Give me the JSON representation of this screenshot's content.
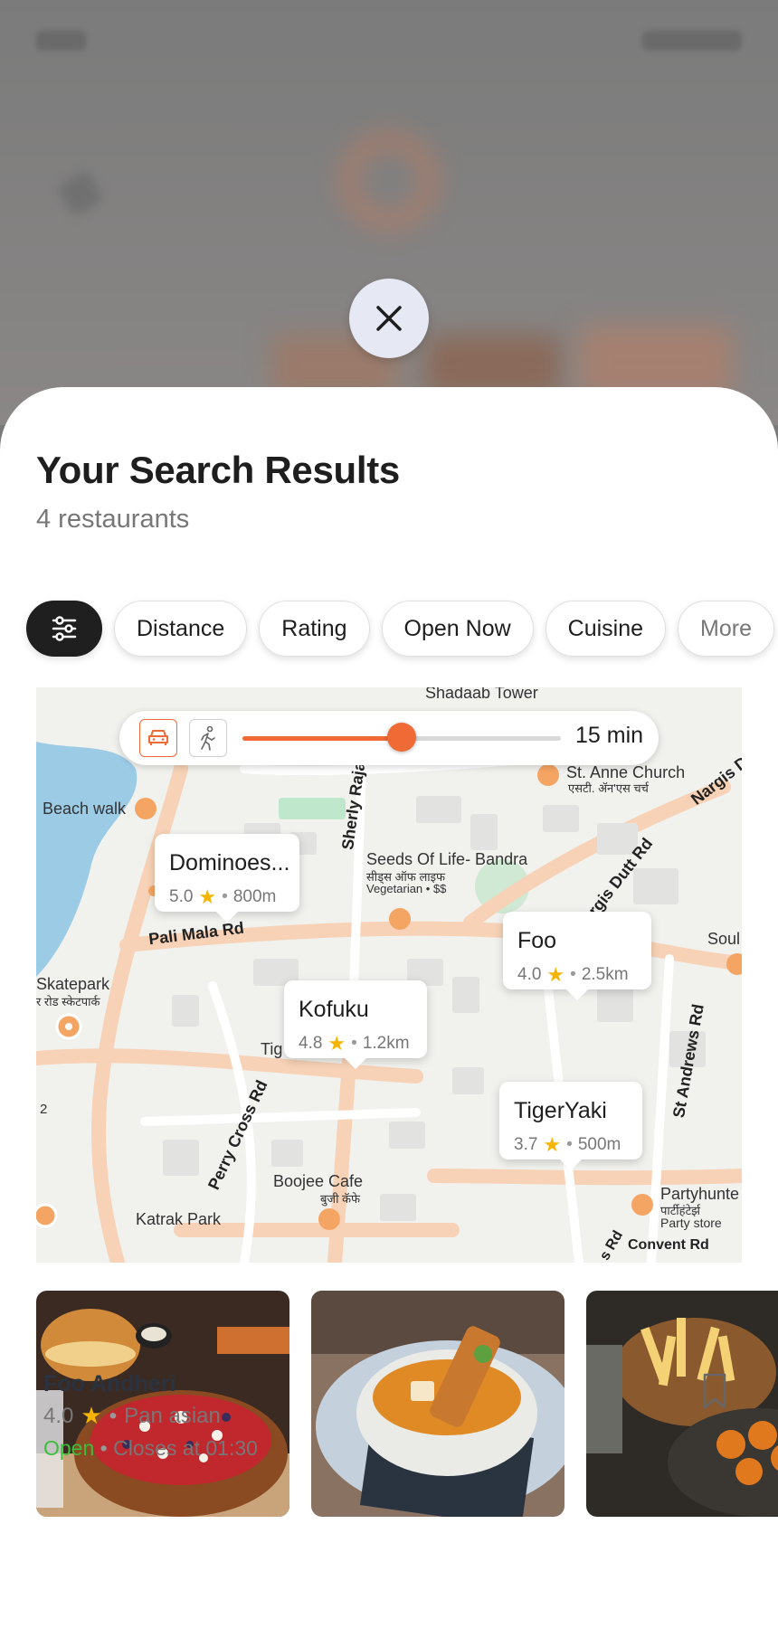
{
  "close": {
    "icon": "close-icon"
  },
  "header": {
    "title": "Your Search Results",
    "subtitle": "4 restaurants"
  },
  "filters": {
    "filter_icon": "sliders-icon",
    "chips": [
      "Distance",
      "Rating",
      "Open Now",
      "Cuisine",
      "More"
    ]
  },
  "map": {
    "travel": {
      "modes": [
        "car-icon",
        "walk-icon"
      ],
      "selected_mode": "car",
      "time_label": "15 min",
      "slider_fraction": 0.5
    },
    "labels": {
      "shadaab": "Shadaab Tower",
      "st_anne": "St. Anne Church",
      "st_anne_hi": "एसटी. ॲन'एस चर्च",
      "beach_walk": "Beach walk",
      "sherly_raja": "Sherly Raja",
      "nargis": "Nargis Dutt",
      "seeds": "Seeds Of Life- Bandra",
      "seeds_hi": "सीड्स ऑफ लाइफ",
      "seeds_sub": "Vegetarian • $$",
      "nargis_dutt_rd": "Nargis Dutt Rd",
      "pali_mala": "Pali Mala Rd",
      "soul": "Soul",
      "skatepark": "Skatepark",
      "skatepark_hi": "र रोड स्केटपार्क",
      "tig": "Tig",
      "st_andrews": "St Andrews Rd",
      "perry_cross": "Perry Cross Rd",
      "two": "2",
      "boojee": "Boojee Cafe",
      "boojee_hi": "बुजी कॅफे",
      "katrak": "Katrak Park",
      "partyhunter": "Partyhunte",
      "partyhunter_hi": "पार्टीहंटेर्झ",
      "party_store": "Party store",
      "convent": "Convent Rd",
      "s_rd": "s Rd"
    },
    "pins": [
      {
        "name": "Dominoes...",
        "rating": "5.0",
        "distance": "800m"
      },
      {
        "name": "Foo",
        "rating": "4.0",
        "distance": "2.5km"
      },
      {
        "name": "Kofuku",
        "rating": "4.8",
        "distance": "1.2km"
      },
      {
        "name": "TigerYaki",
        "rating": "3.7",
        "distance": "500m"
      }
    ]
  },
  "restaurant": {
    "name": "Foo Andheri",
    "rating": "4.0",
    "cuisine": "Pan asian",
    "status": "Open",
    "closes": "Closes at 01:30",
    "bookmark_icon": "bookmark-icon"
  },
  "colors": {
    "accent": "#f06a35",
    "star": "#f5b400",
    "open": "#3bbf3b",
    "dark_chip": "#1f1f1f"
  }
}
